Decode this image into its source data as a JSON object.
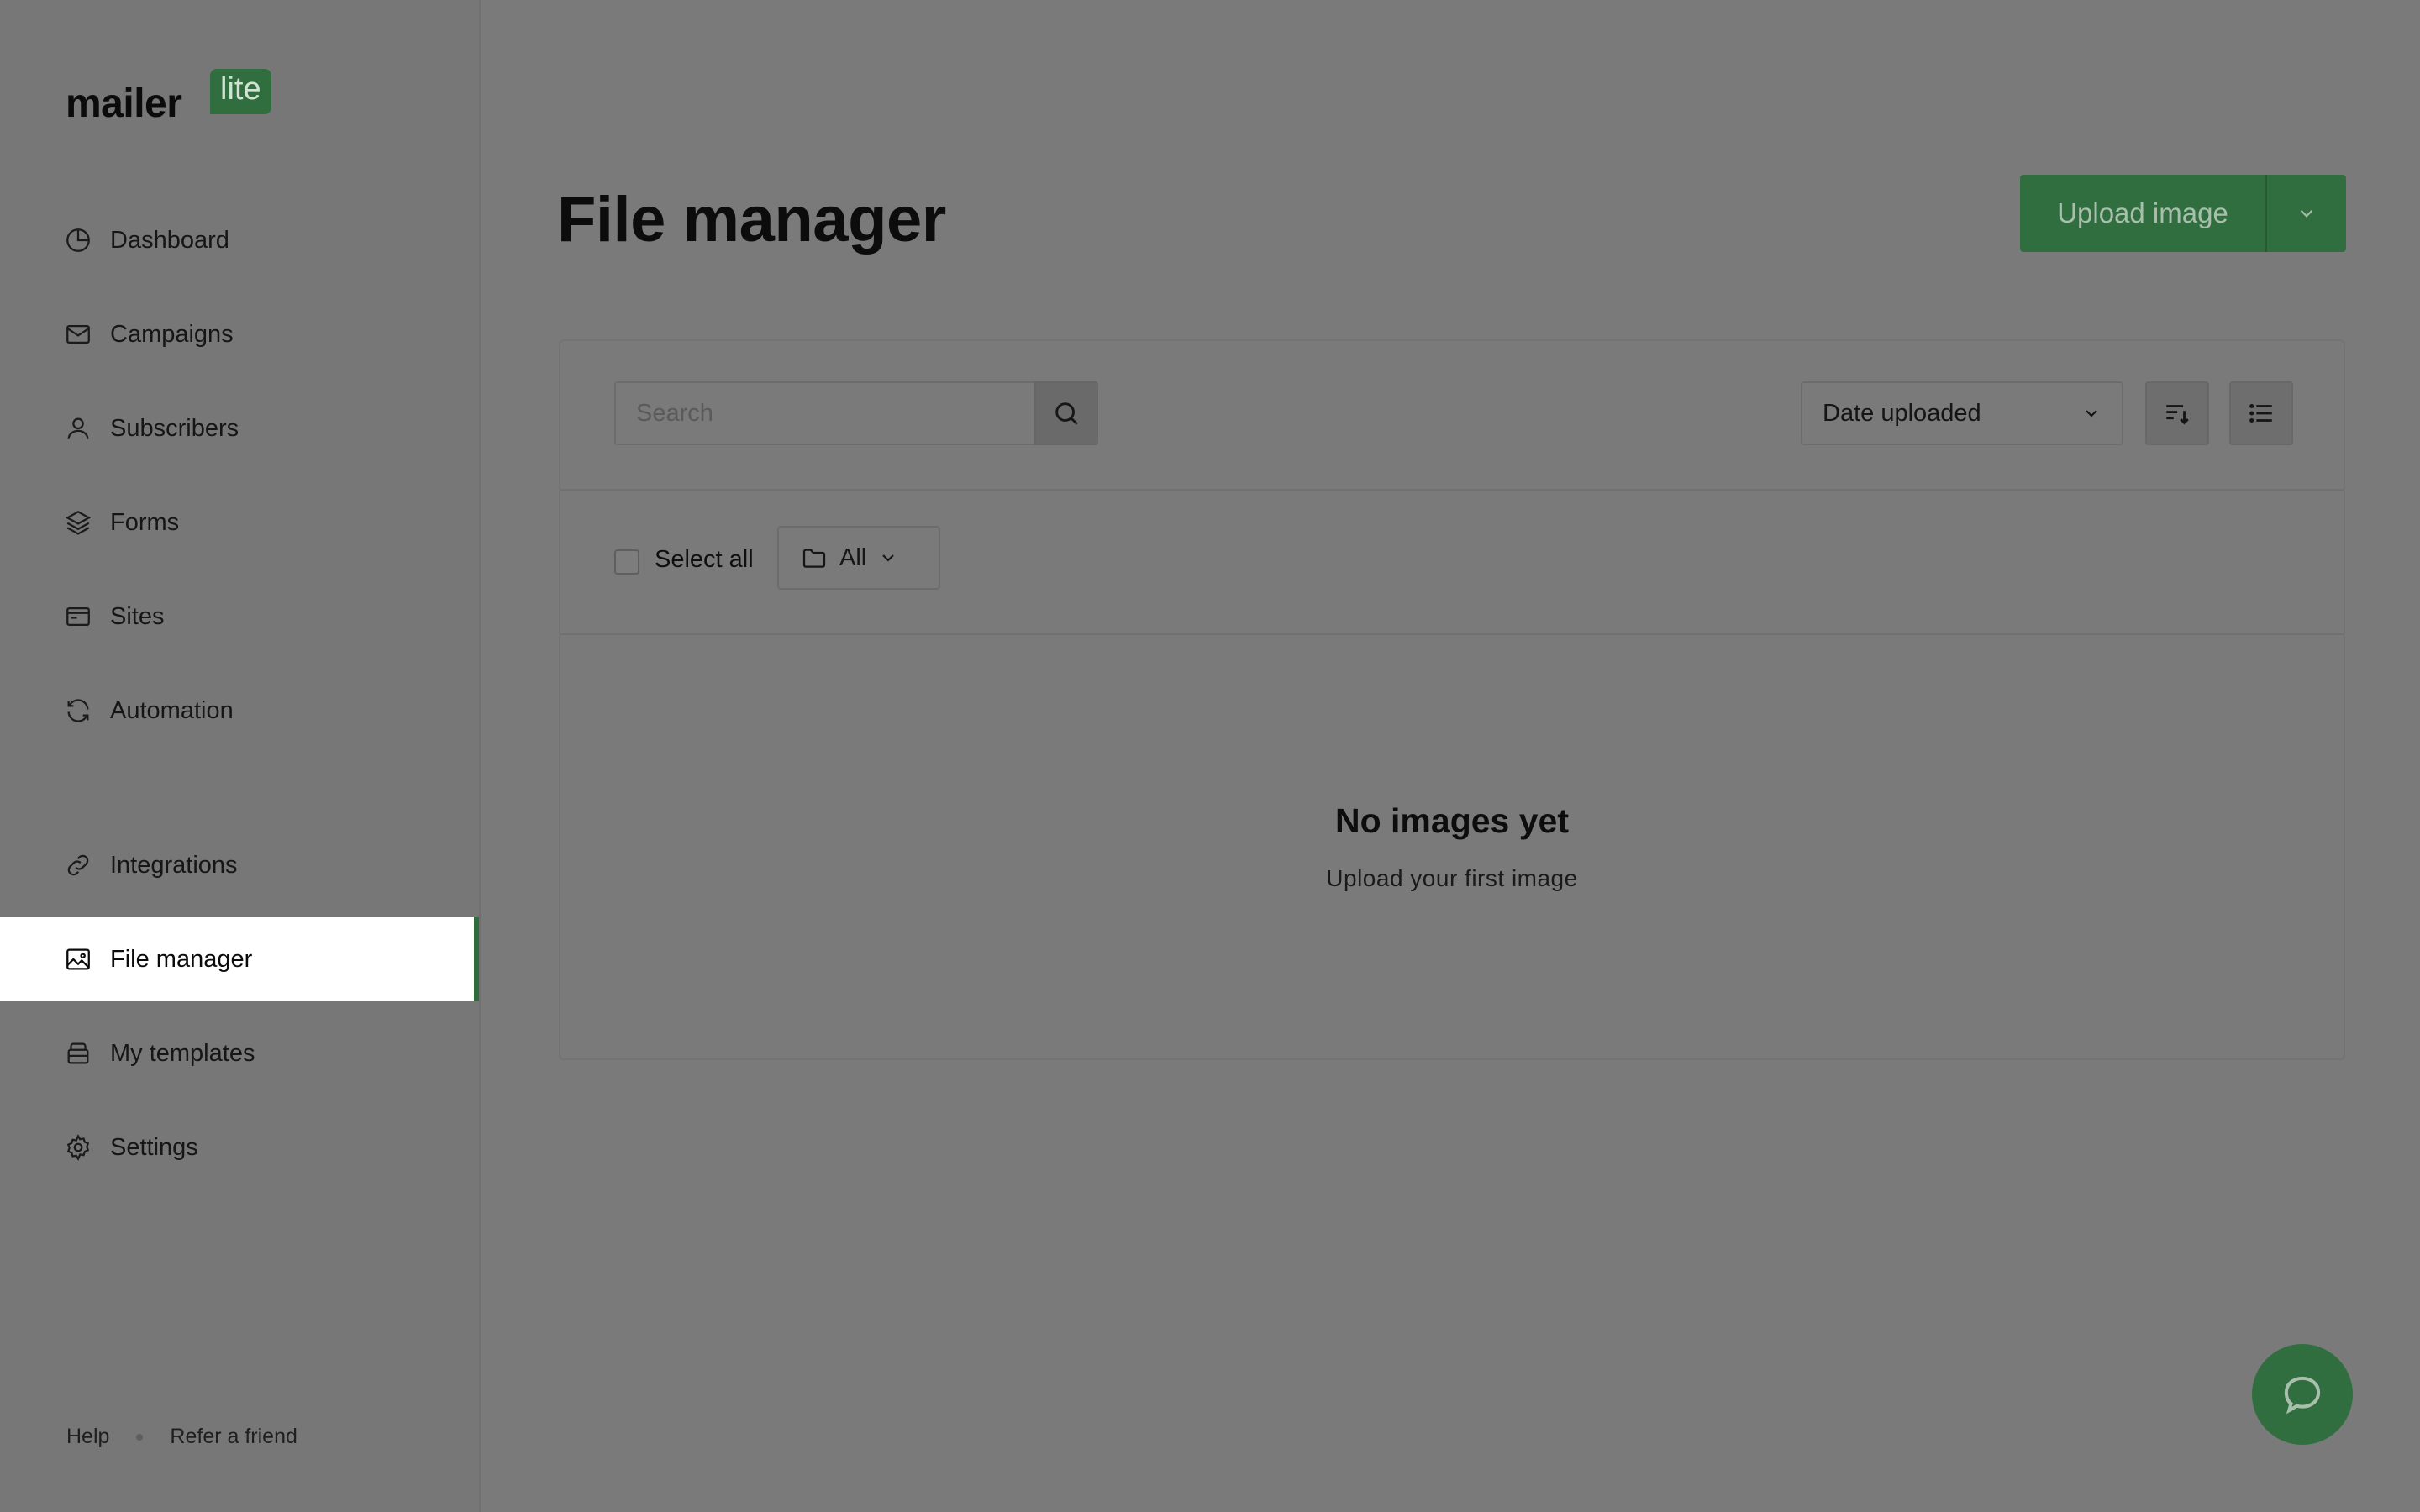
{
  "logo": {
    "word": "mailer",
    "badge": "lite"
  },
  "sidebar": {
    "items": [
      {
        "label": "Dashboard",
        "icon": "pie-chart-icon"
      },
      {
        "label": "Campaigns",
        "icon": "envelope-icon"
      },
      {
        "label": "Subscribers",
        "icon": "user-icon"
      },
      {
        "label": "Forms",
        "icon": "layers-icon"
      },
      {
        "label": "Sites",
        "icon": "browser-icon"
      },
      {
        "label": "Automation",
        "icon": "refresh-icon"
      },
      {
        "label": "Integrations",
        "icon": "link-icon"
      },
      {
        "label": "File manager",
        "icon": "image-icon",
        "active": true
      },
      {
        "label": "My templates",
        "icon": "template-icon"
      },
      {
        "label": "Settings",
        "icon": "gear-icon"
      }
    ],
    "footer": {
      "help": "Help",
      "refer": "Refer a friend"
    }
  },
  "main": {
    "title": "File manager",
    "upload_label": "Upload image",
    "search": {
      "placeholder": "Search",
      "value": ""
    },
    "sort": {
      "selected": "Date uploaded"
    },
    "select_all": "Select all",
    "folder": {
      "selected": "All"
    },
    "empty": {
      "title": "No images yet",
      "subtitle": "Upload your first image"
    }
  },
  "colors": {
    "brand_green": "#316e3f",
    "active_bg": "#ffffff",
    "overlay_gray": "#7a7a7b"
  }
}
